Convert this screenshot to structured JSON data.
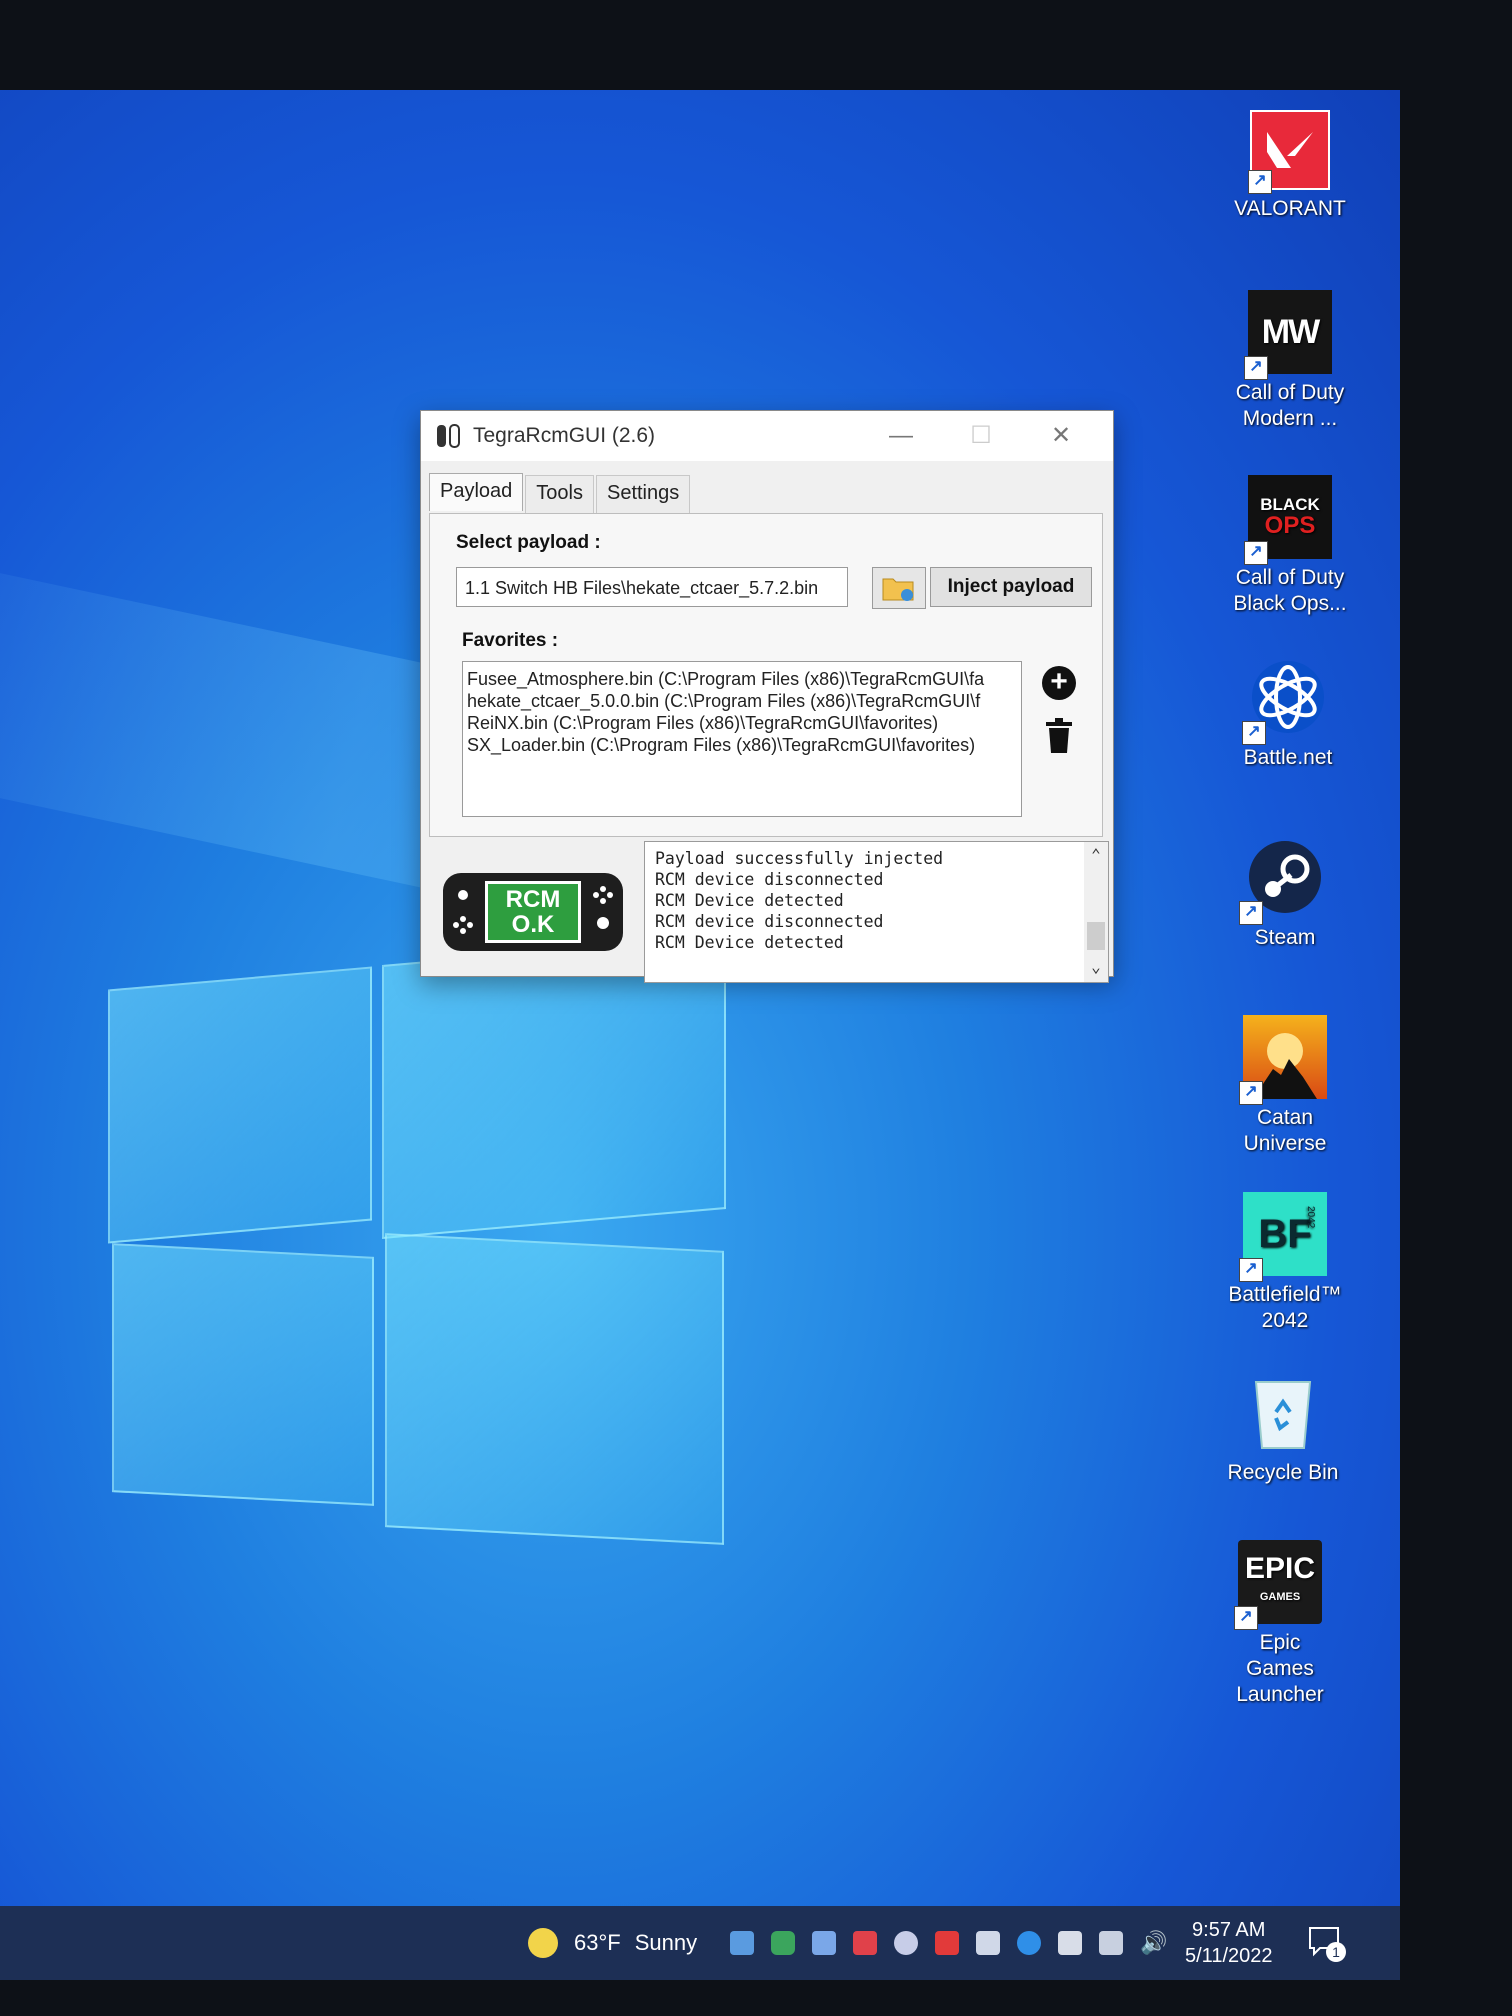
{
  "window": {
    "title": "TegraRcmGUI (2.6)",
    "tabs": [
      "Payload",
      "Tools",
      "Settings"
    ],
    "select_payload_label": "Select payload :",
    "payload_path": "1.1 Switch HB Files\\hekate_ctcaer_5.7.2.bin",
    "inject_button": "Inject payload",
    "favorites_label": "Favorites :",
    "favorites": [
      "Fusee_Atmosphere.bin (C:\\Program Files (x86)\\TegraRcmGUI\\fa",
      "hekate_ctcaer_5.0.0.bin (C:\\Program Files (x86)\\TegraRcmGUI\\f",
      "ReiNX.bin (C:\\Program Files (x86)\\TegraRcmGUI\\favorites)",
      "SX_Loader.bin (C:\\Program Files (x86)\\TegraRcmGUI\\favorites)"
    ],
    "rcm_status": [
      "RCM",
      "O.K"
    ],
    "log": [
      "Payload successfully injected",
      "RCM device disconnected",
      "RCM Device detected",
      "RCM device disconnected",
      "RCM Device detected"
    ]
  },
  "desktop_icons": [
    {
      "label": "VALORANT",
      "icon": "valorant-icon"
    },
    {
      "label": "Call of Duty Modern ...",
      "icon": "cod-mw-icon"
    },
    {
      "label": "Call of Duty Black Ops...",
      "icon": "cod-black-ops-icon"
    },
    {
      "label": "Battle.net",
      "icon": "battlenet-icon"
    },
    {
      "label": "Steam",
      "icon": "steam-icon"
    },
    {
      "label": "Catan Universe",
      "icon": "catan-icon"
    },
    {
      "label": "Battlefield™ 2042",
      "icon": "battlefield-icon"
    },
    {
      "label": "Recycle Bin",
      "icon": "recycle-bin-icon"
    },
    {
      "label": "Epic Games Launcher",
      "icon": "epic-games-icon"
    }
  ],
  "icon_text": {
    "mw": "MW",
    "black": "BLACK",
    "ops": "OPS",
    "bf": "BF",
    "bf_year": "2042",
    "epic": "EPIC",
    "games": "GAMES"
  },
  "taskbar": {
    "weather_temp": "63°F",
    "weather_cond": "Sunny",
    "time": "9:57 AM",
    "date": "5/11/2022",
    "notification_count": "1"
  },
  "colors": {
    "accent_green": "#2e9e3f",
    "taskbar": "#1d2f55",
    "valorant_red": "#e8293a"
  }
}
